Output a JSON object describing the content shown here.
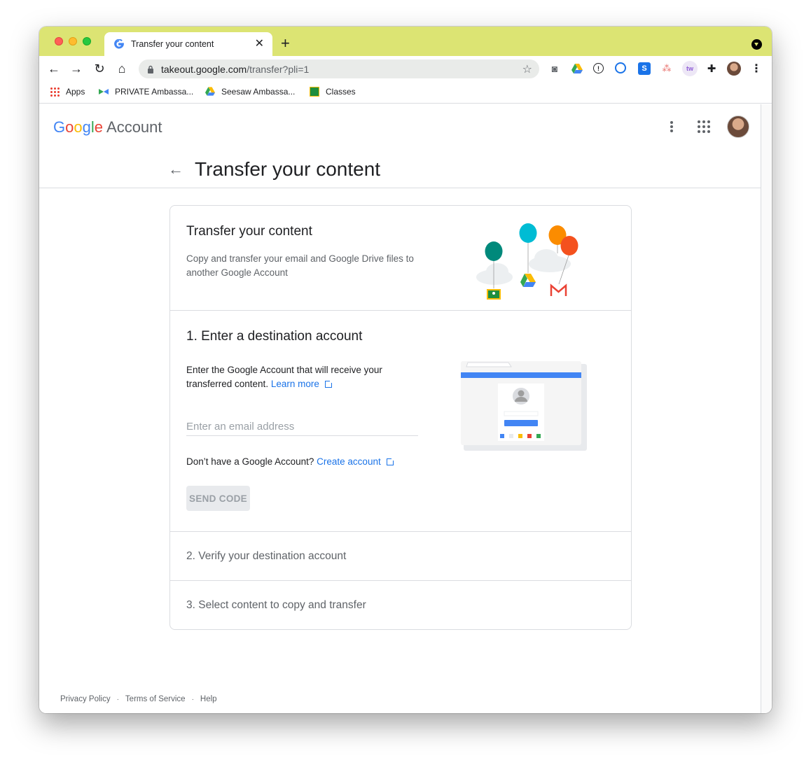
{
  "browser": {
    "tab_title": "Transfer your content",
    "url_host": "takeout.google.com",
    "url_path": "/transfer?pli=1",
    "bookmarks": [
      {
        "label": "Apps"
      },
      {
        "label": "PRIVATE Ambassa..."
      },
      {
        "label": "Seesaw Ambassa..."
      },
      {
        "label": "Classes"
      }
    ]
  },
  "header": {
    "logo_letters": [
      "G",
      "o",
      "o",
      "g",
      "l",
      "e"
    ],
    "logo_suffix": "Account"
  },
  "page": {
    "title": "Transfer your content"
  },
  "intro": {
    "title": "Transfer your content",
    "description": "Copy and transfer your email and Google Drive files to another Google Account"
  },
  "step1": {
    "title": "1. Enter a destination account",
    "description": "Enter the Google Account that will receive your transferred content.",
    "learn_more": "Learn more",
    "email_placeholder": "Enter an email address",
    "no_account_text": "Don’t have a Google Account?",
    "create_account": "Create account",
    "send_code": "SEND CODE"
  },
  "step2": {
    "title": "2. Verify your destination account"
  },
  "step3": {
    "title": "3. Select content to copy and transfer"
  },
  "footer": {
    "privacy": "Privacy Policy",
    "terms": "Terms of Service",
    "help": "Help",
    "separator": "·"
  },
  "colors": {
    "titlebar": "#dce473",
    "link": "#1a73e8",
    "google_blue": "#4285f4",
    "google_red": "#ea4335",
    "google_yellow": "#fbbc05",
    "google_green": "#34a853"
  }
}
